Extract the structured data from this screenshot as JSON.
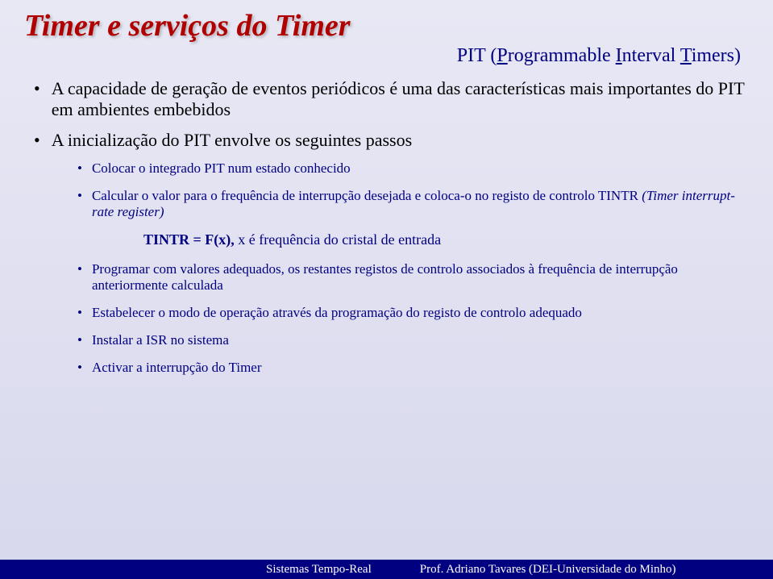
{
  "title": "Timer e serviços do Timer",
  "subtitle_prefix": "PIT (",
  "subtitle_p": "P",
  "subtitle_mid1": "rogrammable ",
  "subtitle_i": "I",
  "subtitle_mid2": "nterval ",
  "subtitle_t": "T",
  "subtitle_end": "imers)",
  "bullet1": "A capacidade de geração de eventos periódicos é uma das características mais importantes do PIT em ambientes embebidos",
  "bullet2": "A inicialização do PIT envolve os seguintes passos",
  "sub1": "Colocar o integrado PIT num estado conhecido",
  "sub2": "Calcular o valor para o frequência de interrupção desejada e coloca-o no registo de controlo TINTR (Timer interrupt-rate register)",
  "formula_bold": "TINTR = F(x),",
  "formula_rest": "  x é frequência do cristal de entrada",
  "sub3": "Programar com valores adequados, os restantes registos de controlo associados à frequência de interrupção anteriormente calculada",
  "sub4": "Estabelecer o modo de operação através da programação do registo de controlo adequado",
  "sub5": "Instalar a ISR no sistema",
  "sub6": "Activar a interrupção do Timer",
  "footer_left": "Sistemas Tempo-Real",
  "footer_right": "Prof. Adriano Tavares (DEI-Universidade do Minho)"
}
